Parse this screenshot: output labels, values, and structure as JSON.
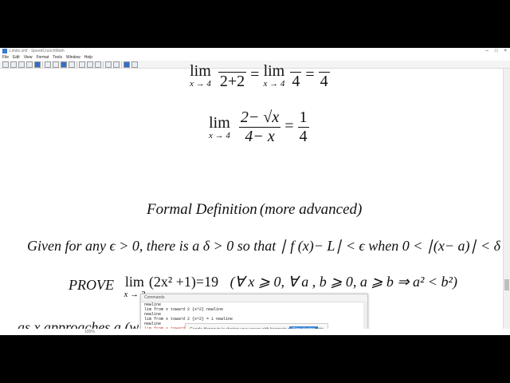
{
  "window": {
    "title": "Limits.smf - SpeedCrunchMath",
    "controls": [
      "–",
      "□",
      "×"
    ]
  },
  "menubar": [
    "File",
    "Edit",
    "View",
    "Format",
    "Tools",
    "Window",
    "Help"
  ],
  "toolbar_icons": [
    "zoom-icon",
    "zoom-icon",
    "cursor-icon",
    "pen-icon",
    "cursor-icon",
    "doc-icon",
    "open-icon",
    "save-icon",
    "print-icon",
    "cut-icon",
    "copy-icon",
    "paste-icon",
    "undo-icon",
    "redo-icon",
    "help-icon",
    "info-icon"
  ],
  "math": {
    "line1": {
      "lim": "lim",
      "sub": "x → 4",
      "den1": "2+2",
      "eq": "=",
      "lim2": "lim",
      "sub2": "x → 4",
      "den2": "4",
      "eq2": "=",
      "den3": "4"
    },
    "line2": {
      "lim": "lim",
      "sub": "x → 4",
      "num": "2− √x",
      "den": "4− x",
      "eq": "=",
      "rnum": "1",
      "rden": "4"
    },
    "heading": {
      "text": "Formal Definition",
      "paren": "(more advanced)"
    },
    "definition": "Given for any ϵ > 0, there is a δ > 0 so that ∣ f (x)− L∣ < ϵ when 0 < ∣(x− a)∣ < δ",
    "prove": {
      "label": "PROVE",
      "lim": "lim",
      "sub": "x → 3",
      "expr": "(2x² +1)=19",
      "cond": "(∀ x ⩾ 0, ∀ a , b ⩾ 0, a ⩾ b ⇒ a² < b²)"
    },
    "partial_line": "as x approaches a (w"
  },
  "commands_panel": {
    "title": "Commands",
    "lines": [
      "newline",
      "lim from x toward 2 {x^2} newline",
      "newline",
      "lim from x toward 2 {x^2} = 1 newline",
      "newline",
      "lim from x toward 2 {x^2} newline"
    ]
  },
  "share_bar": {
    "message": "Google Hangouts is sharing your screen with hangouts.google.com.",
    "stop_label": "Stop sharing",
    "hide_label": "Hide"
  },
  "status": {
    "zoom": "100%"
  }
}
